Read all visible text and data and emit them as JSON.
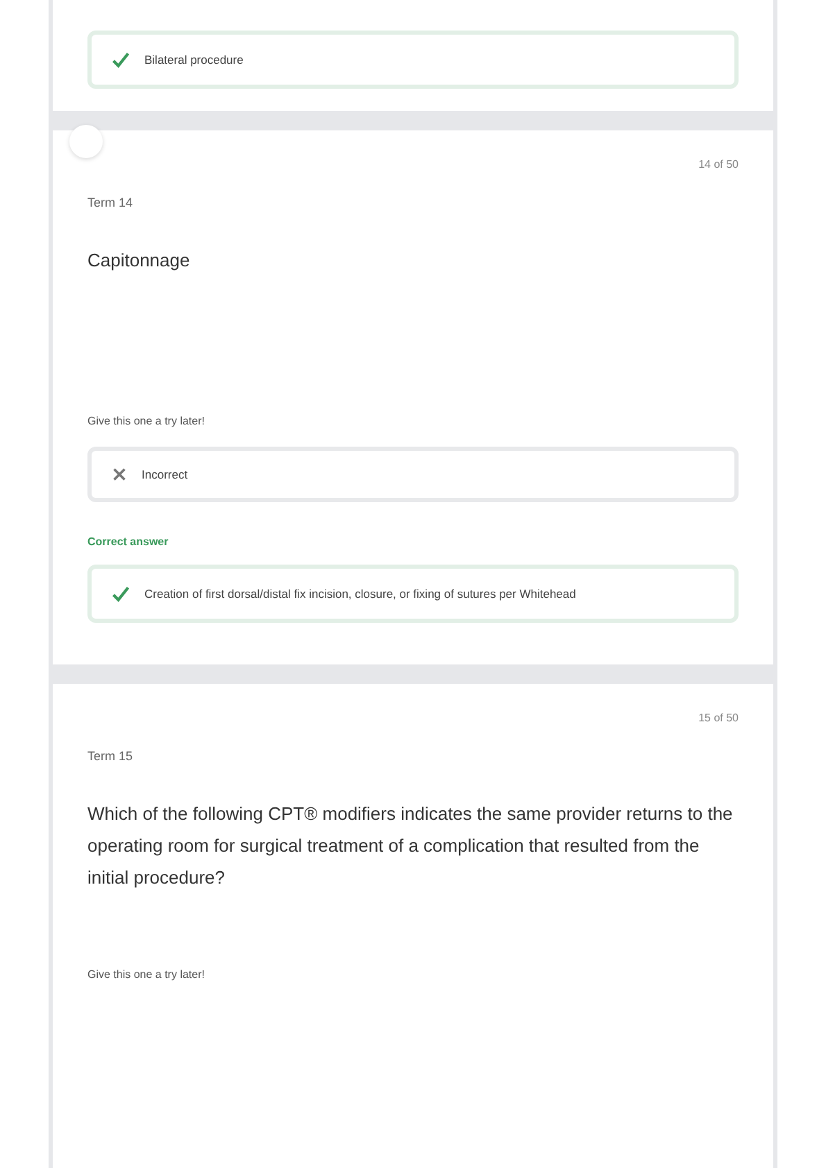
{
  "cards": [
    {
      "answer": {
        "kind": "correct",
        "text": "Bilateral procedure"
      }
    },
    {
      "counter": "14 of 50",
      "term_label": "Term 14",
      "term": "Capitonnage",
      "prompt": "Give this one a try later!",
      "answer": {
        "kind": "wrong",
        "text": "Incorrect"
      },
      "correct_label": "Correct answer",
      "correct": {
        "kind": "correct",
        "text": "Creation of first dorsal/distal fix incision, closure, or fixing of sutures per Whitehead"
      }
    },
    {
      "counter": "15 of 50",
      "term_label": "Term 15",
      "term": "Which of the following CPT® modifiers indicates the same provider returns to the operating room for surgical treatment of a complication that resulted from the initial procedure?",
      "prompt": "Give this one a try later!"
    }
  ]
}
